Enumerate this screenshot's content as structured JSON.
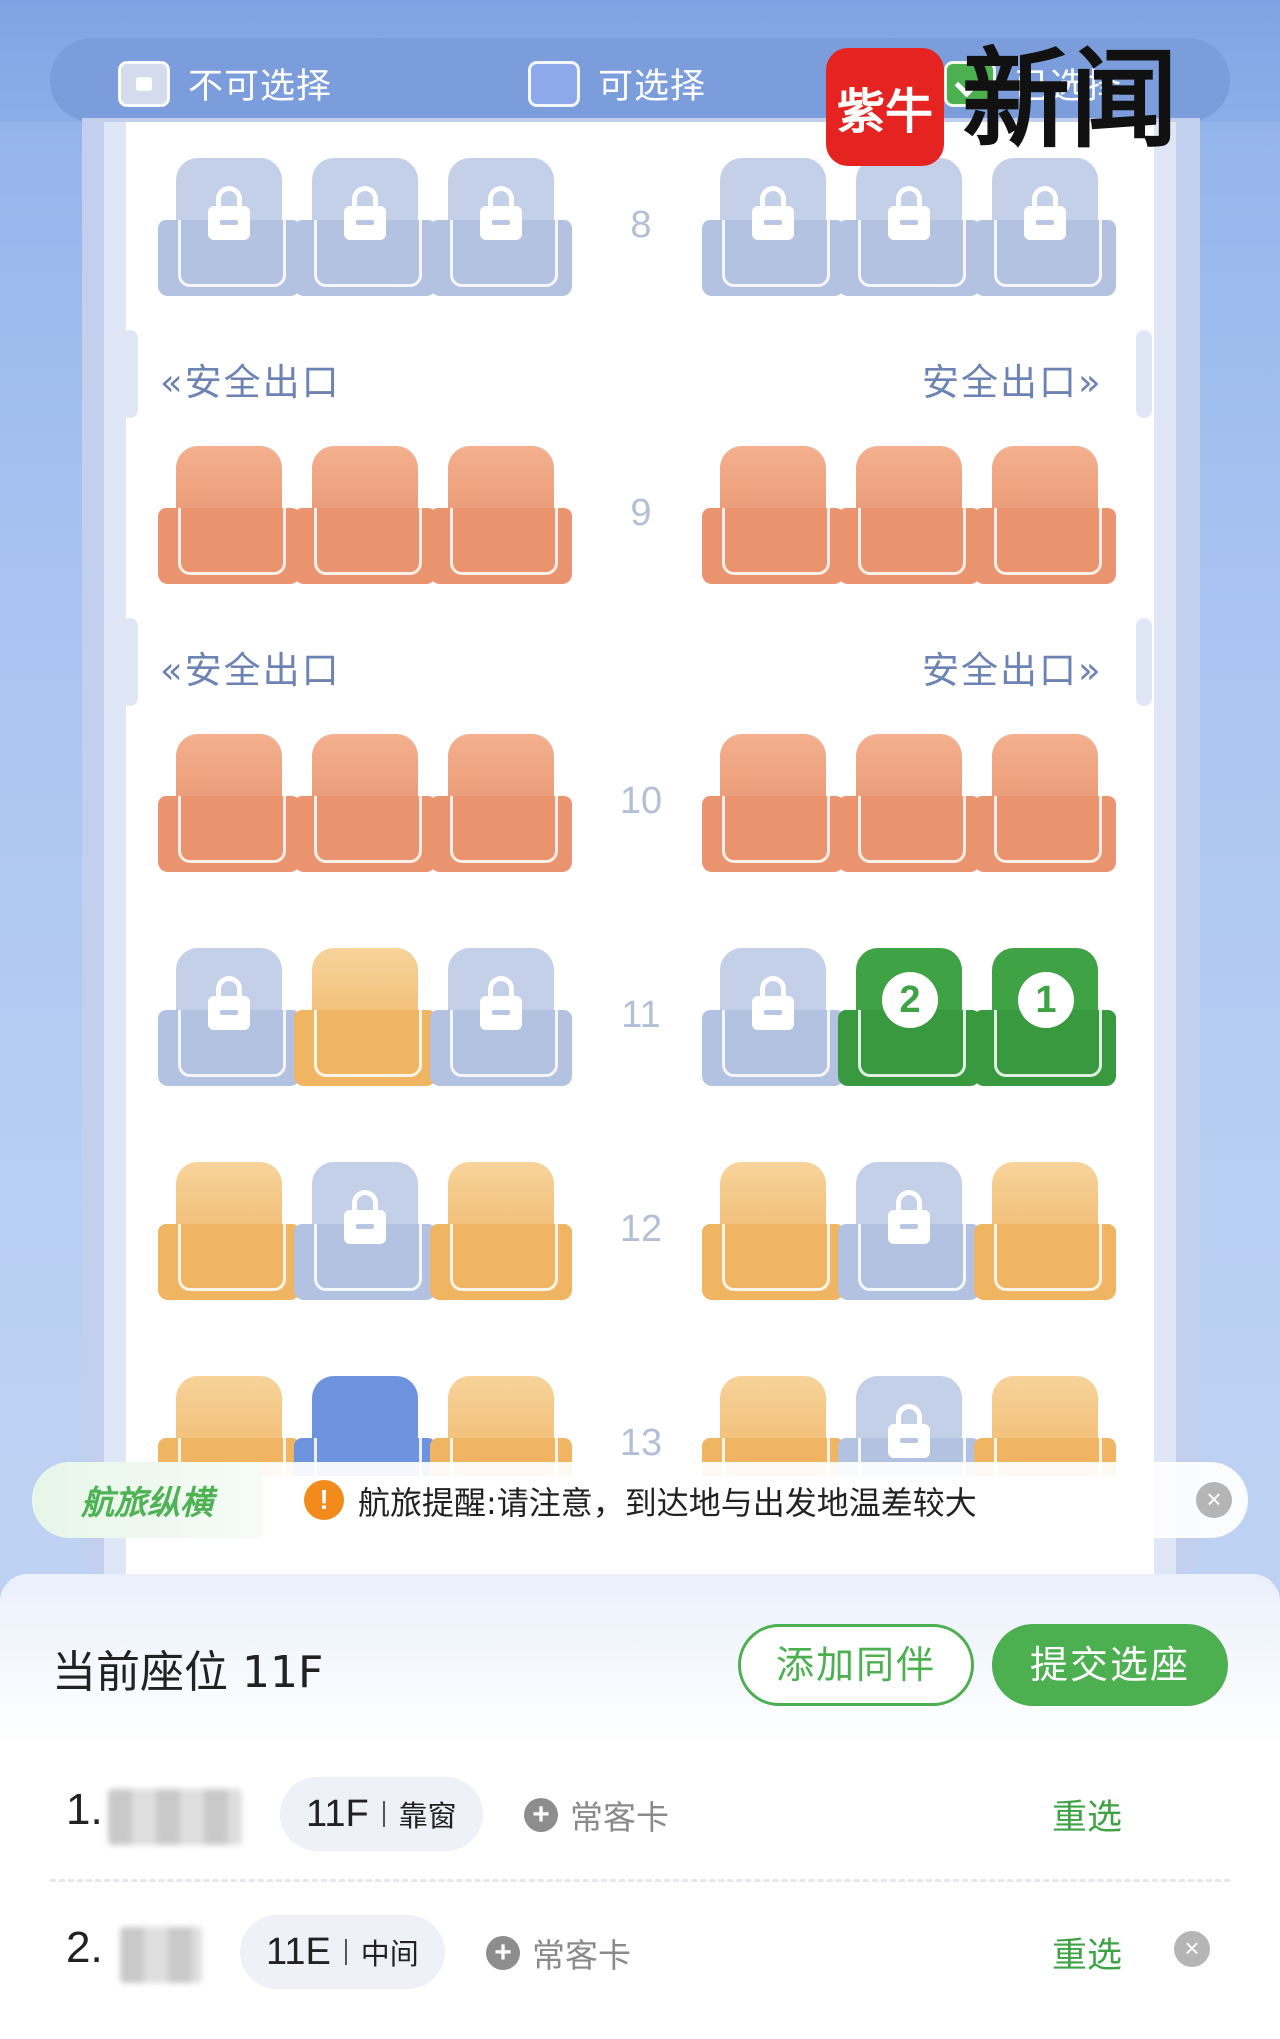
{
  "legend": {
    "unavailable": "不可选择",
    "available": "可选择",
    "selected": "已选择"
  },
  "watermark": {
    "logo_text": "紫牛",
    "text": "新闻"
  },
  "cabin": {
    "exit_label": "安全出口",
    "rows": [
      {
        "number": "8",
        "seats": [
          "locked",
          "locked",
          "locked",
          "locked",
          "locked",
          "locked"
        ]
      },
      {
        "number": "9",
        "seats": [
          "exit",
          "exit",
          "exit",
          "exit",
          "exit",
          "exit"
        ]
      },
      {
        "number": "10",
        "seats": [
          "exit",
          "exit",
          "exit",
          "exit",
          "exit",
          "exit"
        ]
      },
      {
        "number": "11",
        "seats": [
          "locked",
          "available",
          "locked",
          "locked",
          "selected-2",
          "selected-1"
        ]
      },
      {
        "number": "12",
        "seats": [
          "available",
          "locked",
          "available",
          "available",
          "locked",
          "available"
        ]
      },
      {
        "number": "13",
        "seats": [
          "available",
          "blue",
          "available",
          "available",
          "locked",
          "available"
        ]
      }
    ],
    "selection_badges": {
      "second": "2",
      "first": "1"
    }
  },
  "reminder": {
    "brand": "航旅纵横",
    "warn_icon": "!",
    "text": "航旅提醒:请注意，到达地与出发地温差较大",
    "close": "×"
  },
  "panel": {
    "current_seat": "当前座位 11F",
    "add_companion": "添加同伴",
    "submit": "提交选座",
    "passengers": [
      {
        "index": "1.",
        "seat": "11F",
        "position": "靠窗",
        "ff_card": "常客卡",
        "reselect": "重选"
      },
      {
        "index": "2.",
        "seat": "11E",
        "position": "中间",
        "ff_card": "常客卡",
        "reselect": "重选",
        "remove": "×"
      }
    ]
  }
}
